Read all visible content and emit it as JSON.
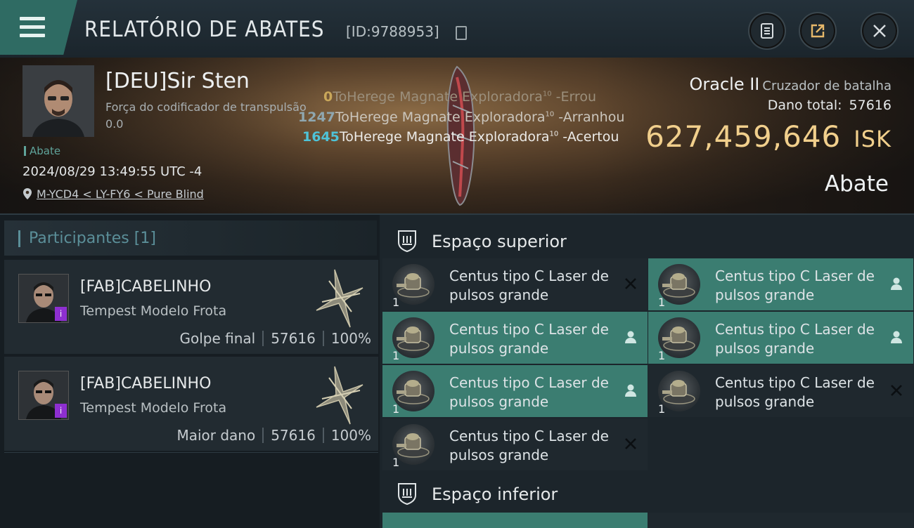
{
  "header": {
    "title": "RELATÓRIO DE ABATES",
    "id_label": "[ID:9788953]"
  },
  "victim": {
    "name": "[DEU]Sir Sten",
    "corporation": "Força do codificador de transpulsão",
    "security": "0.0",
    "tag": "Abate",
    "datetime": "2024/08/29 13:49:55 UTC -4",
    "location": "M-YCD4 < LY-FY6 < Pure Blind"
  },
  "damage_log": [
    {
      "value": "0",
      "text": "ToHerege Magnate Exploradora",
      "level": "10",
      "result": "-Errou",
      "color": "#c9a75a",
      "text_color": "#9b8f7c"
    },
    {
      "value": "1247",
      "text": "ToHerege Magnate Exploradora",
      "level": "10",
      "result": "-Arranhou",
      "color": "#8fa7b0",
      "text_color": "#cbc6bd"
    },
    {
      "value": "1645",
      "text": "ToHerege Magnate Exploradora",
      "level": "10",
      "result": "-Acertou",
      "color": "#4ec3d8",
      "text_color": "#ecebe8"
    }
  ],
  "ship": {
    "name": "Oracle II",
    "class": "Cruzador de batalha",
    "total_damage_label": "Dano total:",
    "total_damage": "57616",
    "isk_value": "627,459,646",
    "isk_unit": "ISK",
    "status": "Abate"
  },
  "participants": {
    "header": "Participantes [1]",
    "list": [
      {
        "name": "[FAB]CABELINHO",
        "ship": "Tempest Modelo Frota",
        "role": "Golpe final",
        "damage": "57616",
        "percent": "100%"
      },
      {
        "name": "[FAB]CABELINHO",
        "ship": "Tempest Modelo Frota",
        "role": "Maior dano",
        "damage": "57616",
        "percent": "100%"
      }
    ]
  },
  "fitting": {
    "high_slots_label": "Espaço superior",
    "low_slots_label": "Espaço inferior",
    "high_slots": [
      {
        "name": "Centus tipo C Laser de pulsos grande",
        "qty": "1",
        "state": "destroyed"
      },
      {
        "name": "Centus tipo C Laser de pulsos grande",
        "qty": "1",
        "state": "dropped"
      },
      {
        "name": "Centus tipo C Laser de pulsos grande",
        "qty": "1",
        "state": "dropped"
      },
      {
        "name": "Centus tipo C Laser de pulsos grande",
        "qty": "1",
        "state": "dropped"
      },
      {
        "name": "Centus tipo C Laser de pulsos grande",
        "qty": "1",
        "state": "dropped"
      },
      {
        "name": "Centus tipo C Laser de pulsos grande",
        "qty": "1",
        "state": "destroyed"
      },
      {
        "name": "Centus tipo C Laser de pulsos grande",
        "qty": "1",
        "state": "destroyed"
      }
    ]
  },
  "colors": {
    "accent_teal": "#3b7d71",
    "isk_gold": "#f1cf8c",
    "badge_purple": "#8e2fd0"
  }
}
